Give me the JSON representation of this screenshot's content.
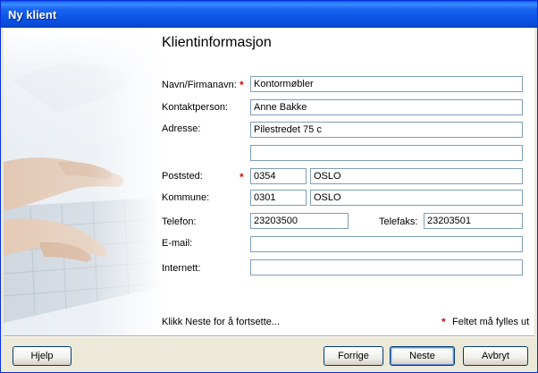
{
  "window": {
    "title": "Ny klient"
  },
  "page": {
    "heading": "Klientinformasjon"
  },
  "form": {
    "navn": {
      "label": "Navn/Firmanavn:",
      "value": "Kontormøbler",
      "required": true
    },
    "kontakt": {
      "label": "Kontaktperson:",
      "value": "Anne Bakke"
    },
    "adresse": {
      "label": "Adresse:",
      "line1": "Pilestredet 75 c",
      "line2": ""
    },
    "poststed": {
      "label": "Poststed:",
      "code": "0354",
      "name": "OSLO",
      "required": true
    },
    "kommune": {
      "label": "Kommune:",
      "code": "0301",
      "name": "OSLO"
    },
    "telefon": {
      "label": "Telefon:",
      "value": "23203500"
    },
    "telefaks": {
      "label": "Telefaks:",
      "value": "23203501"
    },
    "email": {
      "label": "E-mail:",
      "value": ""
    },
    "internett": {
      "label": "Internett:",
      "value": ""
    }
  },
  "hint": "Klikk Neste for å fortsette...",
  "required_note": "Feltet må fylles ut",
  "required_marker": "*",
  "buttons": {
    "help": "Hjelp",
    "back": "Forrige",
    "next": "Neste",
    "cancel": "Avbryt"
  },
  "colors": {
    "title_bar": "#0a54e3",
    "required": "#d01010",
    "field_border": "#7f9db9"
  }
}
